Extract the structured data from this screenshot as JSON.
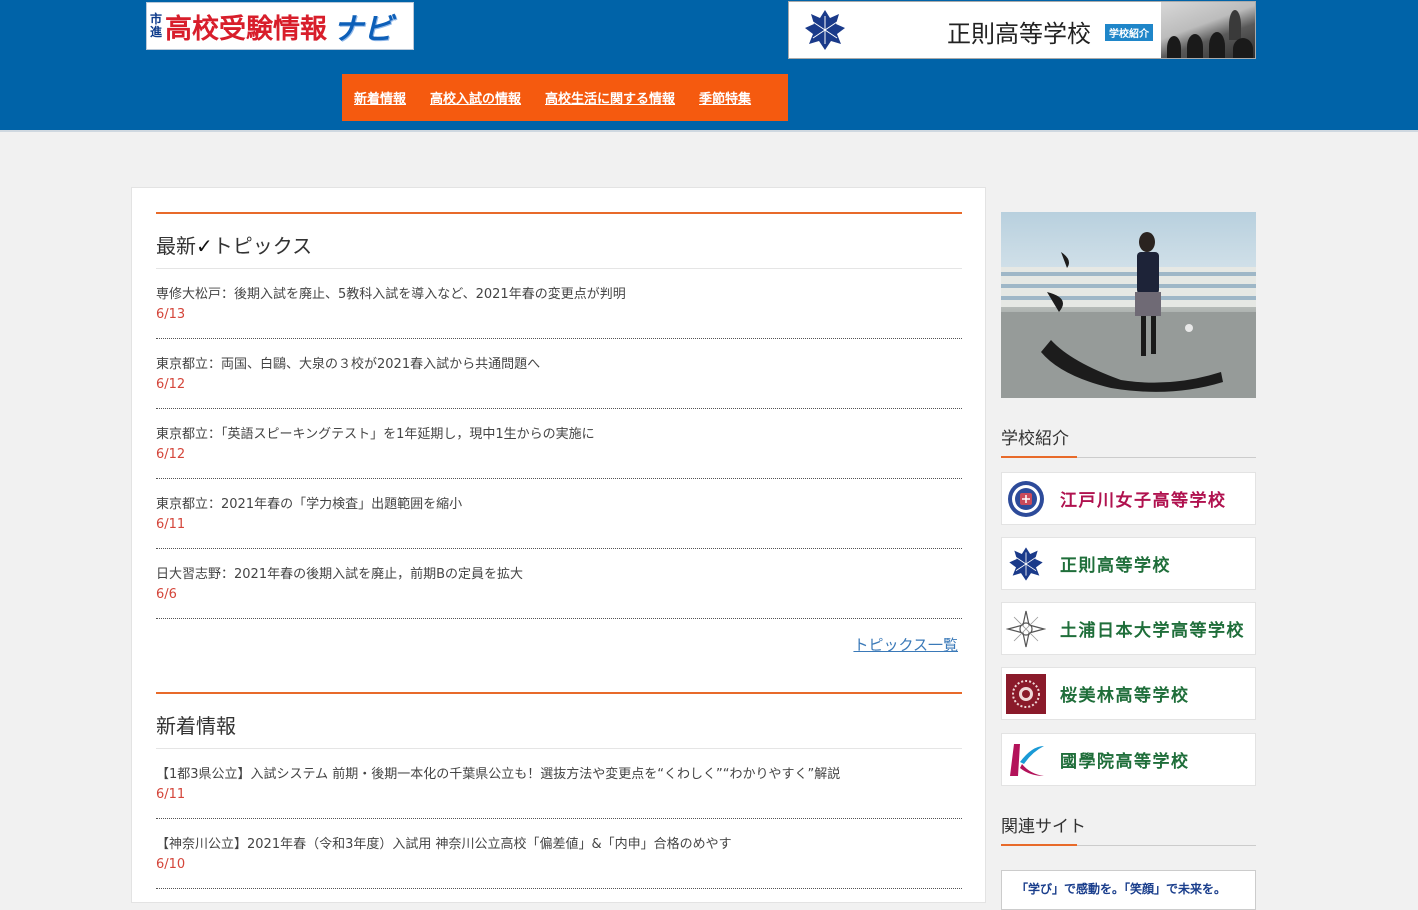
{
  "header": {
    "logo_small": [
      "市",
      "進"
    ],
    "logo_main": "高校受験情報",
    "logo_navi": "ナビ",
    "banner": {
      "title": "正則高等学校",
      "badge": "学校紹介"
    },
    "nav": [
      "新着情報",
      "高校入試の情報",
      "高校生活に関する情報",
      "季節特集"
    ]
  },
  "topics": {
    "title_prefix": "最新",
    "title_check": "✓",
    "title_suffix": "トピックス",
    "items": [
      {
        "title": "専修大松戸：後期入試を廃止、5教科入試を導入など、2021年春の変更点が判明",
        "date": "6/13"
      },
      {
        "title": "東京都立：両国、白鷗、大泉の３校が2021春入試から共通問題へ",
        "date": "6/12"
      },
      {
        "title": "東京都立：「英語スピーキングテスト」を1年延期し，現中1生からの実施に",
        "date": "6/12"
      },
      {
        "title": "東京都立：2021年春の「学力検査」出題範囲を縮小",
        "date": "6/11"
      },
      {
        "title": "日大習志野：2021年春の後期入試を廃止，前期Bの定員を拡大",
        "date": "6/6"
      }
    ],
    "more": "トピックス一覧"
  },
  "news": {
    "title": "新着情報",
    "items": [
      {
        "title": "【1都3県公立】入試システム 前期・後期一本化の千葉県公立も！選抜方法や変更点を“くわしく”“わかりやすく”解説",
        "date": "6/11"
      },
      {
        "title": "【神奈川公立】2021年春（令和3年度）入試用 神奈川公立高校「偏差値」&「内申」合格のめやす",
        "date": "6/10"
      }
    ]
  },
  "sidebar": {
    "school_heading": "学校紹介",
    "schools": [
      {
        "name": "江戸川女子高等学校",
        "color": "#b0124f",
        "icon": "edogawa-crest-icon"
      },
      {
        "name": "正則高等学校",
        "color": "#1f6e3a",
        "icon": "seisoku-crest-icon"
      },
      {
        "name": "土浦日本大学高等学校",
        "color": "#1f6e3a",
        "icon": "tsuchiura-crest-icon"
      },
      {
        "name": "桜美林高等学校",
        "color": "#1f6e3a",
        "icon": "obirin-crest-icon"
      },
      {
        "name": "國學院高等学校",
        "color": "#1f6e3a",
        "icon": "kokugakuin-crest-icon"
      }
    ],
    "related_heading": "関連サイト",
    "related_banner": "「学び」で感動を。「笑顔」で未来を。"
  },
  "colors": {
    "header_bg": "#0063a8",
    "nav_bg": "#f55a0f",
    "accent": "#e86a2a",
    "date": "#d4453a"
  }
}
